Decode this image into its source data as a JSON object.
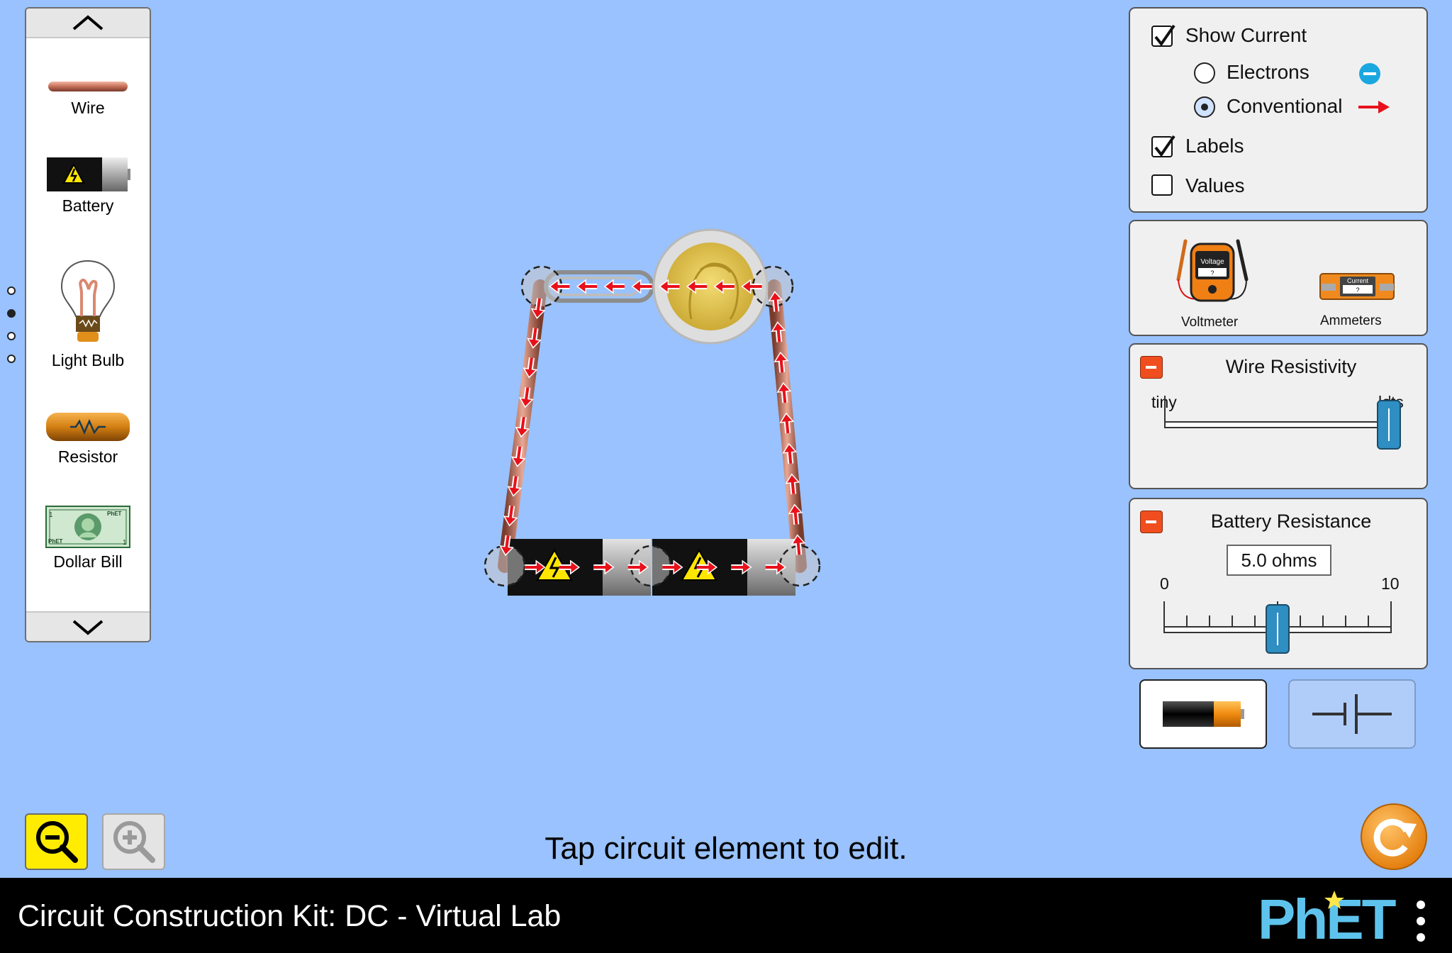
{
  "toolbox": {
    "items": [
      {
        "label": "Wire",
        "icon": "wire-icon"
      },
      {
        "label": "Battery",
        "icon": "battery-icon"
      },
      {
        "label": "Light Bulb",
        "icon": "light-bulb-icon"
      },
      {
        "label": "Resistor",
        "icon": "resistor-icon"
      },
      {
        "label": "Dollar Bill",
        "icon": "dollar-bill-icon"
      }
    ],
    "dollar_bill_marks": {
      "denomination": "1",
      "brand": "PhET"
    },
    "pages": 4,
    "active_page": 2
  },
  "view_panel": {
    "show_current_label": "Show Current",
    "show_current_checked": true,
    "electrons_label": "Electrons",
    "conventional_label": "Conventional",
    "selected_current_type": "Conventional",
    "labels_label": "Labels",
    "labels_checked": true,
    "values_label": "Values",
    "values_checked": false
  },
  "meters_panel": {
    "voltmeter_label": "Voltmeter",
    "voltmeter_display": "Voltage",
    "voltmeter_reading": "?",
    "ammeter_label": "Ammeters",
    "ammeter_display": "Current",
    "ammeter_reading": "?"
  },
  "wire_resistivity": {
    "title": "Wire Resistivity",
    "min_label": "tiny",
    "max_label": "lots",
    "value_fraction": 1.0
  },
  "battery_resistance": {
    "title": "Battery Resistance",
    "readout": "5.0 ohms",
    "min_label": "0",
    "max_label": "10",
    "value": 5.0
  },
  "view_toggle": {
    "selected": "lifelike"
  },
  "status_text": "Tap circuit element to edit.",
  "footer": {
    "title": "Circuit Construction Kit: DC - Virtual Lab",
    "brand": "PhET"
  },
  "colors": {
    "background": "#99c2fe",
    "current_arrow": "#e8111b",
    "electron": "#1aa7e0",
    "minus_button": "#f04e1e",
    "slider_thumb": "#2f8ec2",
    "reset": "#f3901d",
    "zoom_active": "#ffec00"
  }
}
